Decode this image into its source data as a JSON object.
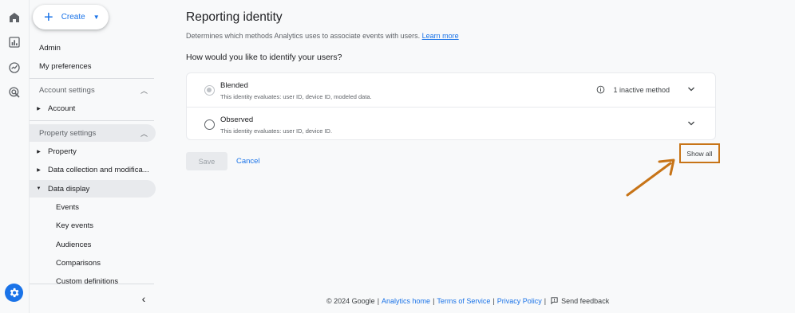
{
  "rail": {
    "icons": [
      "home-icon",
      "reports-icon",
      "explore-icon",
      "advertising-icon"
    ],
    "settings_icon": "gear-icon"
  },
  "sidebar": {
    "create_label": "Create",
    "admin": "Admin",
    "my_preferences": "My preferences",
    "account_settings": "Account settings",
    "account": "Account",
    "property_settings": "Property settings",
    "property": "Property",
    "data_collection": "Data collection and modifica...",
    "data_display": "Data display",
    "sub_items": [
      "Events",
      "Key events",
      "Audiences",
      "Comparisons",
      "Custom definitions"
    ]
  },
  "main": {
    "title": "Reporting identity",
    "description": "Determines which methods Analytics uses to associate events with users.",
    "learn_more": "Learn more",
    "question": "How would you like to identify your users?",
    "options": [
      {
        "name": "Blended",
        "desc": "This identity evaluates: user ID, device ID, modeled data.",
        "info": "1 inactive method",
        "selected": true
      },
      {
        "name": "Observed",
        "desc": "This identity evaluates: user ID, device ID.",
        "info": "",
        "selected": false
      }
    ],
    "save_label": "Save",
    "cancel_label": "Cancel",
    "show_all_label": "Show all"
  },
  "footer": {
    "copyright": "© 2024 Google",
    "analytics_home": "Analytics home",
    "terms": "Terms of Service",
    "privacy": "Privacy Policy",
    "feedback": "Send feedback"
  },
  "colors": {
    "accent": "#1a73e8",
    "annotation": "#c77417"
  }
}
